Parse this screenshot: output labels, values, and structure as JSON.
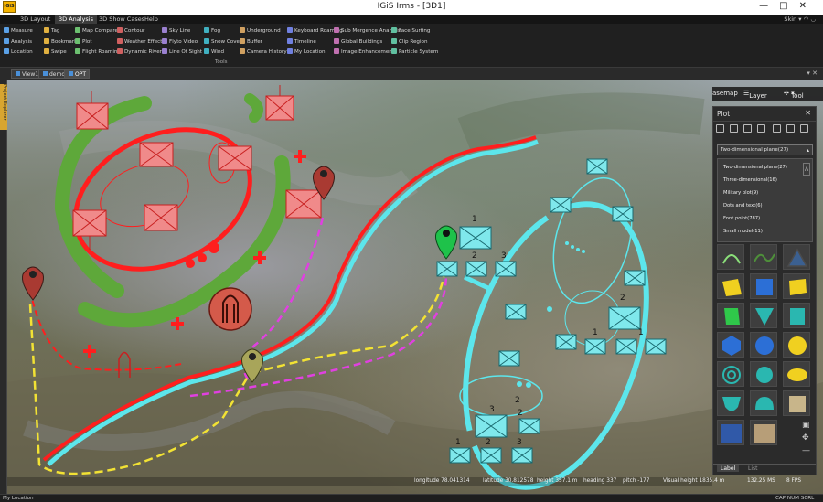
{
  "window": {
    "title": "IGiS Irms - [3D1]",
    "logo_text": "IGiS",
    "controls": [
      "—",
      "□",
      "✕"
    ]
  },
  "menu": {
    "tabs": [
      "3D Layout",
      "3D Analysis",
      "3D Show Cases",
      "Help"
    ],
    "active_tab": "3D Analysis",
    "skin_label": "Skin"
  },
  "ribbon": {
    "items": [
      "Measure",
      "Tag",
      "Map Compare",
      "Contour",
      "Sky Line",
      "Fog",
      "Underground",
      "Keyboard Roaming",
      "Sub Mergence Analysis",
      "Face Surfing",
      "Analysis",
      "Bookmarks",
      "Plot",
      "Weather Effects",
      "Flyto Video",
      "Snow Cover",
      "Buffer",
      "Timeline",
      "Global Buildings",
      "Clip Region",
      "Location",
      "Swipe",
      "Flight Roaming",
      "Dynamic River",
      "Line Of Sight",
      "Wind",
      "Camera History",
      "My Location",
      "Image Enhancement",
      "Particle System"
    ],
    "group_label": "Tools"
  },
  "doc_tabs": [
    "View1",
    "demo",
    "OPT"
  ],
  "side_panel_label": "Project Explorer",
  "overlay_toolbar": {
    "basemap": "asemap",
    "layer": "Layer",
    "tool": "Tool"
  },
  "plot_panel": {
    "title": "Plot",
    "close": "✕",
    "combo_value": "Two-dimensional plane(27)",
    "dropdown_options": [
      "Two-dimensional plane(27)",
      "Three-dimensional(16)",
      "Military plot(9)",
      "Dots and text(6)",
      "Font point(787)",
      "Small model(11)"
    ],
    "bottom_tabs": [
      "Label",
      "List"
    ]
  },
  "map": {
    "labels": [
      "1",
      "2",
      "3",
      "1",
      "2",
      "3",
      "1",
      "2",
      "3",
      "2",
      "1",
      "2"
    ]
  },
  "map_status": {
    "longitude": "longitude 78.041314",
    "latitude": "latitude 30.812578",
    "height": "height 357.1 m",
    "heading": "heading 337",
    "pitch": "pitch -177",
    "visual_height": "Visual height 1835.4 m",
    "ms": "132.25 MS",
    "fps": "8 FPS"
  },
  "app_status": {
    "left": "My Location",
    "right": "CAP  NUM  SCRL"
  },
  "colors": {
    "red_line": "#ff1e1e",
    "cyan_line": "#5ce6ec",
    "green_band": "#5ea83a",
    "magenta_dash": "#e040e0",
    "yellow_dash": "#f2e234",
    "symbol_fill": "#f08a8a",
    "cyan_symbol": "#7fe8ec"
  }
}
